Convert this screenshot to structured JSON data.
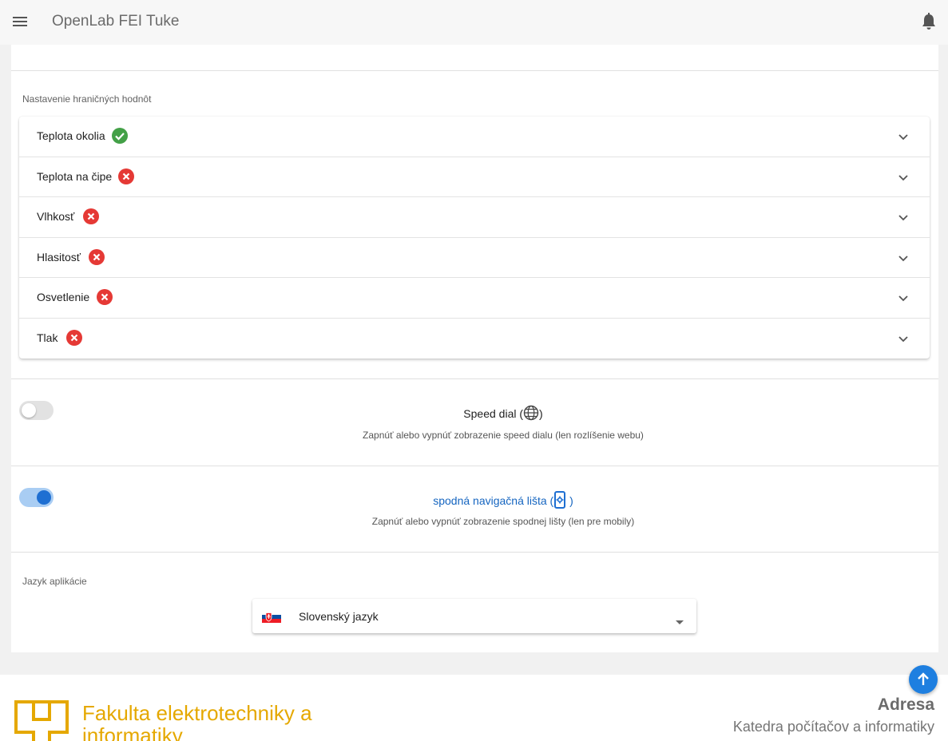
{
  "appbar": {
    "title": "OpenLab FEI Tuke",
    "menu_icon": "menu-icon",
    "notifications_icon": "bell-icon"
  },
  "thresholds": {
    "section_label": "Nastavenie hraničných hodnôt",
    "panels": [
      {
        "label": "Teplota okolia",
        "status": "ok"
      },
      {
        "label": "Teplota na čipe",
        "status": "error"
      },
      {
        "label": "Vlhkosť",
        "status": "error"
      },
      {
        "label": "Hlasitosť",
        "status": "error"
      },
      {
        "label": "Osvetlenie",
        "status": "error"
      },
      {
        "label": "Tlak",
        "status": "error"
      }
    ],
    "colors": {
      "ok": "#43a047",
      "error": "#e53935"
    }
  },
  "speed_dial": {
    "title": "Speed dial (",
    "title_end": ")",
    "icon": "globe-icon",
    "description": "Zapnúť alebo vypnúť zobrazenie speed dialu (len rozlíšenie webu)",
    "enabled": false
  },
  "bottom_nav": {
    "title": "spodná navigačná lišta (",
    "title_end": " )",
    "icon": "mobile-settings-icon",
    "description": "Zapnúť alebo vypnúť zobrazenie spodnej lišty (len pre mobily)",
    "enabled": true
  },
  "language": {
    "section_label": "Jazyk aplikácie",
    "selected": "Slovenský jazyk",
    "flag_icon": "slovak-flag-icon"
  },
  "footer": {
    "faculty_name": "Fakulta elektrotechniky a informatiky",
    "address_title": "Adresa",
    "address_line": "Katedra počítačov a informatiky"
  },
  "theme": {
    "accent": "#1e7fe0",
    "link": "#1565c0",
    "faculty_gold": "#e5a800"
  }
}
